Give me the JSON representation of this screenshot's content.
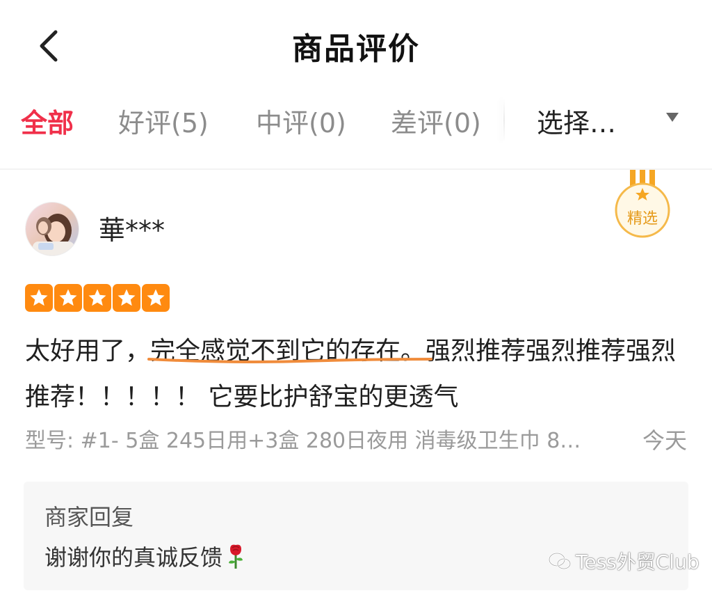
{
  "header": {
    "title": "商品评价",
    "back_icon": "chevron-left-icon"
  },
  "tabs": [
    {
      "label": "全部",
      "active": true
    },
    {
      "label": "好评(5)",
      "active": false
    },
    {
      "label": "中评(0)",
      "active": false
    },
    {
      "label": "差评(0)",
      "active": false
    }
  ],
  "filter": {
    "label": "选择…",
    "icon": "caret-down-icon"
  },
  "review": {
    "username": "華***",
    "badge": {
      "label": "精选"
    },
    "rating": 5,
    "rating_max": 5,
    "text_before": "太好用了，",
    "text_highlight": "完全感觉不到它的存在",
    "text_after": "。强烈推荐强烈推荐强烈推荐！！！！！ 它要比护舒宝的更透气",
    "variant": "型号: #1- 5盒 245日用+3盒 280日夜用 消毒级卫生巾 8…",
    "date": "今天"
  },
  "merchant_reply": {
    "title": "商家回复",
    "text": "谢谢你的真诚反馈",
    "emoji_icon": "rose-icon"
  },
  "watermark": {
    "text": "Tess外贸Club"
  },
  "colors": {
    "accent": "#f0304a",
    "star": "#ff8a10",
    "badge": "#f5a623",
    "highlight_underline": "#f08c3c"
  }
}
